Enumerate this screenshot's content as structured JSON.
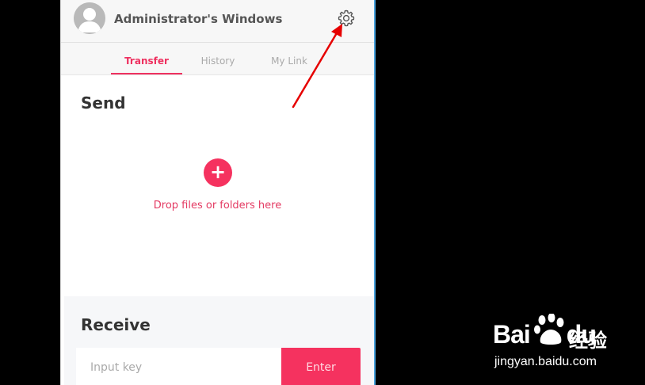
{
  "header": {
    "user_title": "Administrator's Windows",
    "avatar_icon": "user-avatar-icon",
    "settings_icon": "gear-icon"
  },
  "tabs": [
    {
      "label": "Transfer",
      "active": true
    },
    {
      "label": "History",
      "active": false
    },
    {
      "label": "My Link",
      "active": false
    }
  ],
  "send": {
    "title": "Send",
    "add_label": "+",
    "drop_text": "Drop files or folders here"
  },
  "receive": {
    "title": "Receive",
    "input_placeholder": "Input key",
    "input_value": "",
    "enter_label": "Enter"
  },
  "watermark": {
    "logo_text": "Bai",
    "logo_text_2": "du",
    "chinese_text": "经验",
    "url": "jingyan.baidu.com"
  },
  "colors": {
    "accent": "#f5325f",
    "accent_text": "#e43b63",
    "tab_inactive": "#aaaaaa",
    "header_bg": "#f7f7f7",
    "receive_bg": "#f6f7f9",
    "annotation_arrow": "#e60000"
  }
}
